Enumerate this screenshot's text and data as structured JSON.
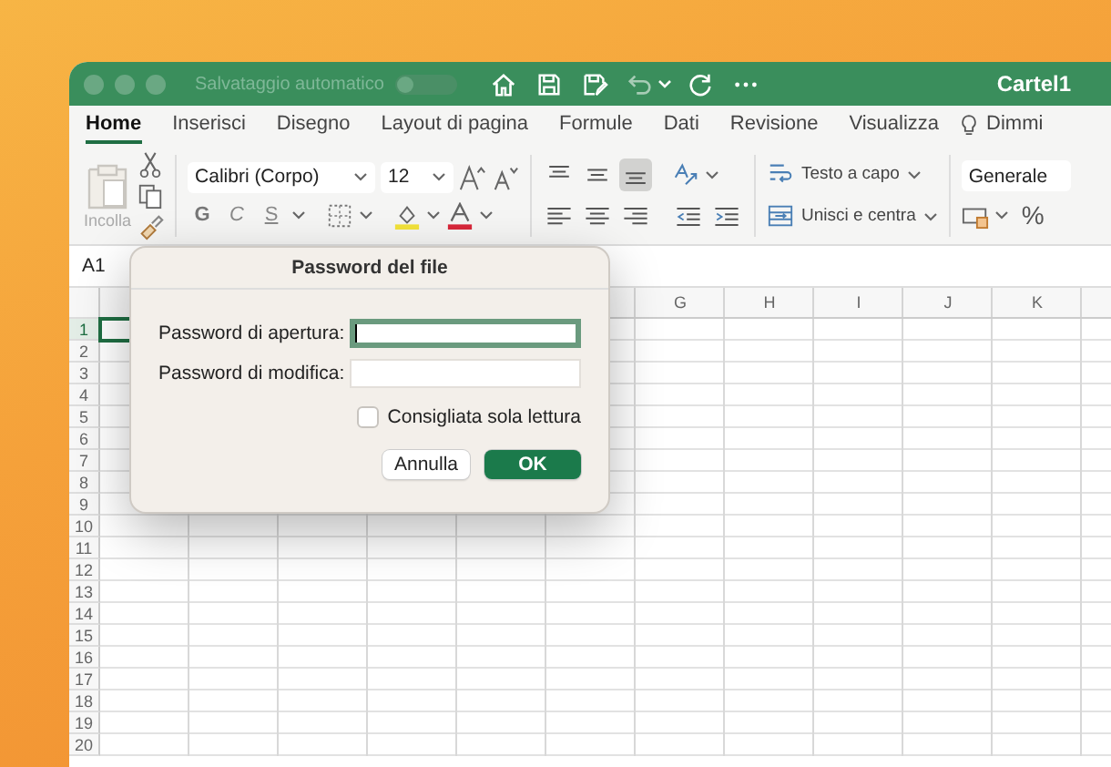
{
  "window": {
    "title": "Cartel1",
    "autosave": {
      "label": "Salvataggio automatico",
      "on": false
    }
  },
  "tabs": [
    {
      "label": "Home",
      "selected": true
    },
    {
      "label": "Inserisci",
      "selected": false
    },
    {
      "label": "Disegno",
      "selected": false
    },
    {
      "label": "Layout di pagina",
      "selected": false
    },
    {
      "label": "Formule",
      "selected": false
    },
    {
      "label": "Dati",
      "selected": false
    },
    {
      "label": "Revisione",
      "selected": false
    },
    {
      "label": "Visualizza",
      "selected": false
    }
  ],
  "tell_me": "Dimmi",
  "ribbon": {
    "paste_label": "Incolla",
    "font_name": "Calibri (Corpo)",
    "font_size": "12",
    "style_buttons": [
      "G",
      "C",
      "S"
    ],
    "vertical_align_buttons": [
      {
        "selected": false
      },
      {
        "selected": false
      },
      {
        "selected": true
      }
    ],
    "wrap_text": "Testo a capo",
    "merge_center": "Unisci e centra",
    "number_format": "Generale",
    "percent": "%"
  },
  "name_box": "A1",
  "sheet": {
    "columns": [
      {
        "label": "G"
      },
      {
        "label": "H"
      },
      {
        "label": "I"
      },
      {
        "label": "J"
      },
      {
        "label": "K"
      }
    ],
    "rows": [
      {
        "label": "1",
        "selected": true
      },
      {
        "label": "2",
        "selected": false
      },
      {
        "label": "3",
        "selected": false
      },
      {
        "label": "4",
        "selected": false
      },
      {
        "label": "5",
        "selected": false
      },
      {
        "label": "6",
        "selected": false
      },
      {
        "label": "7",
        "selected": false
      },
      {
        "label": "8",
        "selected": false
      },
      {
        "label": "9",
        "selected": false
      },
      {
        "label": "10",
        "selected": false
      },
      {
        "label": "11",
        "selected": false
      },
      {
        "label": "12",
        "selected": false
      },
      {
        "label": "13",
        "selected": false
      },
      {
        "label": "14",
        "selected": false
      },
      {
        "label": "15",
        "selected": false
      },
      {
        "label": "16",
        "selected": false
      },
      {
        "label": "17",
        "selected": false
      },
      {
        "label": "18",
        "selected": false
      },
      {
        "label": "19",
        "selected": false
      },
      {
        "label": "20",
        "selected": false
      }
    ]
  },
  "dialog": {
    "title": "Password del file",
    "fields": [
      {
        "label": "Password di apertura:",
        "focused": true
      },
      {
        "label": "Password di modifica:",
        "focused": false
      }
    ],
    "read_only_checkbox": {
      "label": "Consigliata sola lettura",
      "checked": false
    },
    "buttons": [
      {
        "label": "Annulla",
        "default": false
      },
      {
        "label": "OK",
        "default": true
      }
    ]
  }
}
